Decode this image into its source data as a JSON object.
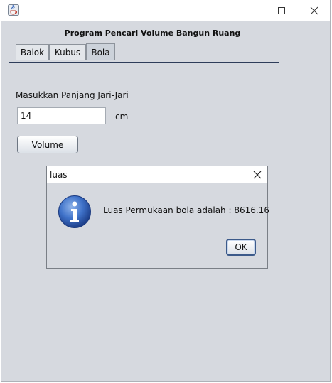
{
  "window": {
    "app_icon": "java-cup-icon",
    "minimize_icon": "minimize-icon",
    "maximize_icon": "maximize-icon",
    "close_icon": "close-icon"
  },
  "main": {
    "heading": "Program Pencari Volume Bangun Ruang",
    "tabs": [
      {
        "label": "Balok",
        "active": false
      },
      {
        "label": "Kubus",
        "active": false
      },
      {
        "label": "Bola",
        "active": true
      }
    ],
    "radius_label": "Masukkan Panjang Jari-Jari",
    "radius_value": "14",
    "unit": "cm",
    "volume_button": "Volume"
  },
  "dialog": {
    "title": "luas",
    "icon": "info-icon",
    "message": "Luas Permukaan bola adalah : 8616.16",
    "ok_button": "OK"
  },
  "colors": {
    "window_bg": "#d6d9df",
    "accent": "#2e3d5a",
    "info_blue": "#2a5db8"
  }
}
